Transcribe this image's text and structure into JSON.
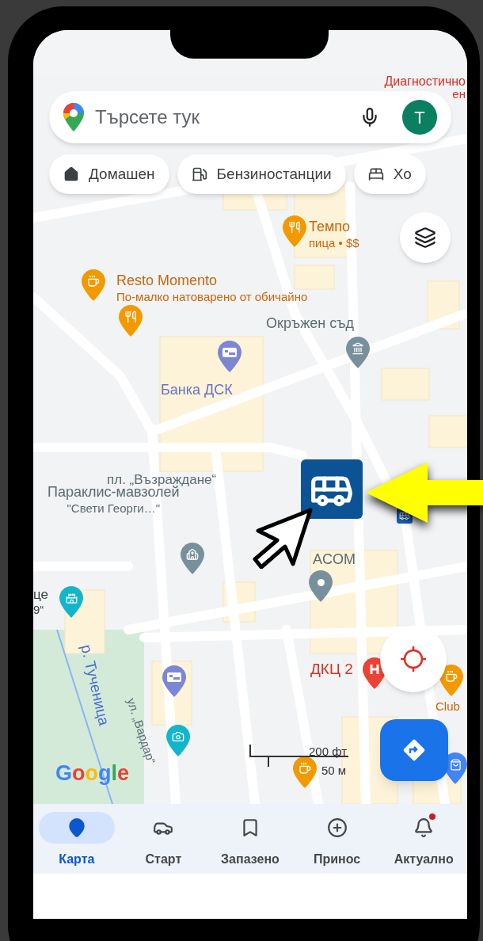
{
  "search": {
    "placeholder": "Търсете тук",
    "avatar": "T"
  },
  "chips": [
    {
      "label": "Домашен"
    },
    {
      "label": "Бензиностанции"
    },
    {
      "label": "Хо"
    }
  ],
  "places": [
    {
      "name": "Диагностично",
      "detail": "ен",
      "color": "#d93025"
    },
    {
      "name": "Темпо",
      "detail": "пица • $$",
      "color": "#c8650c"
    },
    {
      "name": "Resto Momento",
      "detail": "По-малко натоварено от обичайно",
      "color": "#c8650c"
    },
    {
      "name": "Окръжен съд",
      "color": "#5c6b73"
    },
    {
      "name": "Банка ДСК",
      "color": "#6673c9"
    },
    {
      "name": "пл. „Възраждане“",
      "color": "#5c6b73"
    },
    {
      "name": "Параклис-мавзолей",
      "detail": "\"Свети Георги…\"",
      "color": "#5c6b73"
    },
    {
      "name": "ACOM",
      "color": "#5c6b73"
    },
    {
      "name": "це",
      "detail": "9“",
      "color": "#3c4043"
    },
    {
      "name": "ДКЦ 2",
      "color": "#d93025"
    },
    {
      "name": "Club",
      "color": "#c8650c"
    },
    {
      "name": "р. Тученица",
      "color": "#4a6fd1"
    },
    {
      "name": "ул. „Вардар“",
      "color": "#5c6b73"
    }
  ],
  "logo": "Google",
  "scale": {
    "imperial": "200 фт",
    "metric": "50 м"
  },
  "nav": [
    {
      "label": "Карта",
      "selected": true,
      "badge": false
    },
    {
      "label": "Старт",
      "selected": false,
      "badge": false
    },
    {
      "label": "Запазено",
      "selected": false,
      "badge": false
    },
    {
      "label": "Принос",
      "selected": false,
      "badge": false
    },
    {
      "label": "Актуално",
      "selected": false,
      "badge": true
    }
  ]
}
